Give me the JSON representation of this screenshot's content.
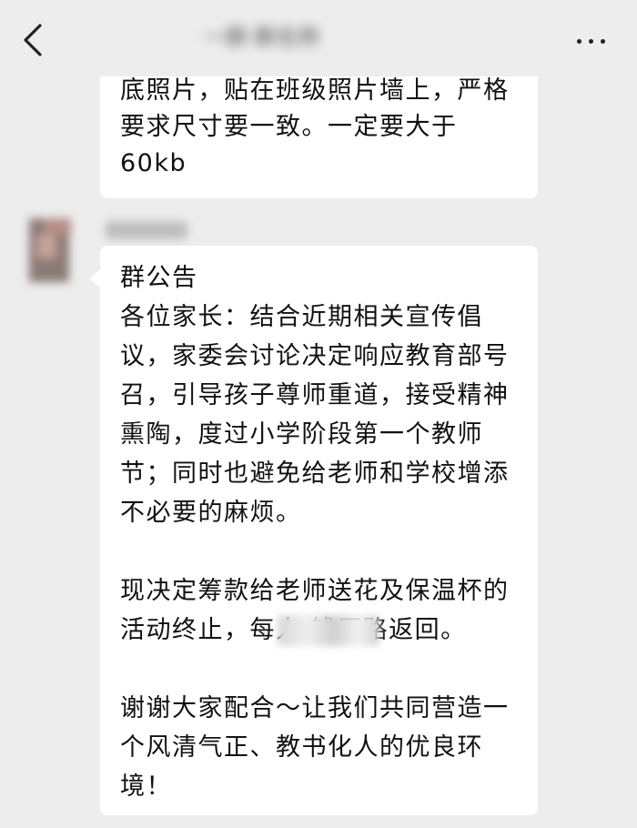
{
  "nav": {
    "back_icon": "chevron-left-icon",
    "title": "一群·群名称",
    "more_icon": "more-dots-icon"
  },
  "messages": [
    {
      "text": "底照片，贴在班级照片墙上，严格\n要求尺寸要一致。一定要大于\n60kb"
    },
    {
      "sender": "",
      "text": "群公告\n各位家长：结合近期相关宣传倡\n议，家委会讨论决定响应教育部号\n召，引导孩子尊师重道，接受精神\n熏陶，度过小学阶段第一个教师\n节；同时也避免给老师和学校增添\n不必要的麻烦。\n\n现决定筹款给老师送花及保温杯的\n活动终止，每人      钱原路返回。\n\n谢谢大家配合～让我们共同营造一\n个风清气正、教书化人的优良环\n境！"
    }
  ]
}
